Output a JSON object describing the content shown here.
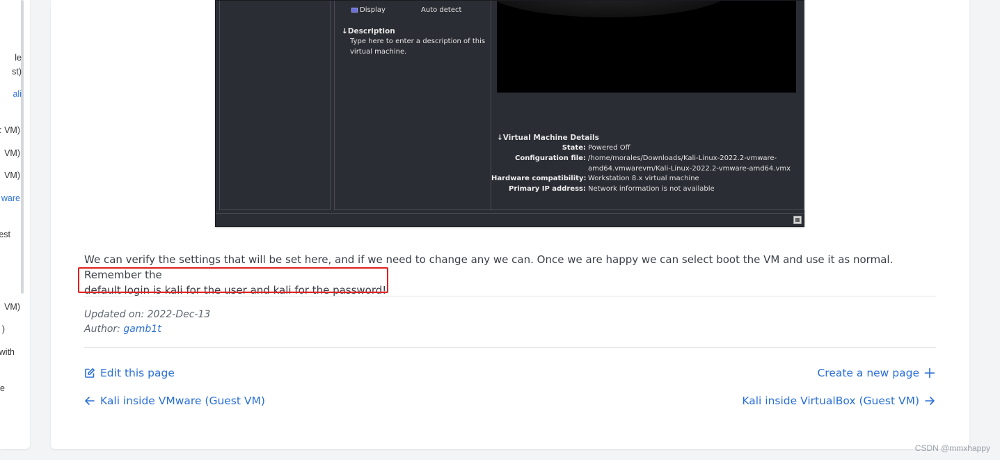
{
  "sidebar": {
    "fragments": [
      "le",
      "st)",
      "ali",
      ": VM)",
      "VM)",
      "VM)",
      "ware",
      "est",
      "VM)",
      ")",
      "with",
      "e"
    ]
  },
  "vm": {
    "hardware": {
      "display_label": "Display",
      "display_value": "Auto detect"
    },
    "description": {
      "heading": "↓Description",
      "text_line1": "Type here to enter a description of this",
      "text_line2": "virtual machine."
    },
    "details": {
      "heading": "↓Virtual Machine Details",
      "rows": [
        {
          "key": "State:",
          "value": "Powered Off"
        },
        {
          "key": "Configuration file:",
          "value": "/home/morales/Downloads/Kali-Linux-2022.2-vmware-"
        },
        {
          "key": "",
          "value": "amd64.vmwarevm/Kali-Linux-2022.2-vmware-amd64.vmx"
        },
        {
          "key": "Hardware compatibility:",
          "value": "Workstation 8.x virtual machine"
        },
        {
          "key": "Primary IP address:",
          "value": "Network information is not available"
        }
      ]
    }
  },
  "article": {
    "paragraph_line1": "We can verify the settings that will be set here, and if we need to change any we can. Once we are happy we can select boot the VM and use it as normal. Remember the",
    "paragraph_line2": "default login is kali for the user and kali for the password!",
    "updated_label": "Updated on: 2022-Dec-13",
    "author_label": "Author: ",
    "author_name": "gamb1t"
  },
  "nav": {
    "edit_page": "Edit this page",
    "create_page": "Create a new page",
    "prev_page": "Kali inside VMware (Guest VM)",
    "next_page": "Kali inside VirtualBox (Guest VM)"
  },
  "watermark": "CSDN @mmxhappy",
  "colors": {
    "link": "#2a6fd6",
    "highlight": "#e02020",
    "vm_bg": "#2b2d34"
  }
}
